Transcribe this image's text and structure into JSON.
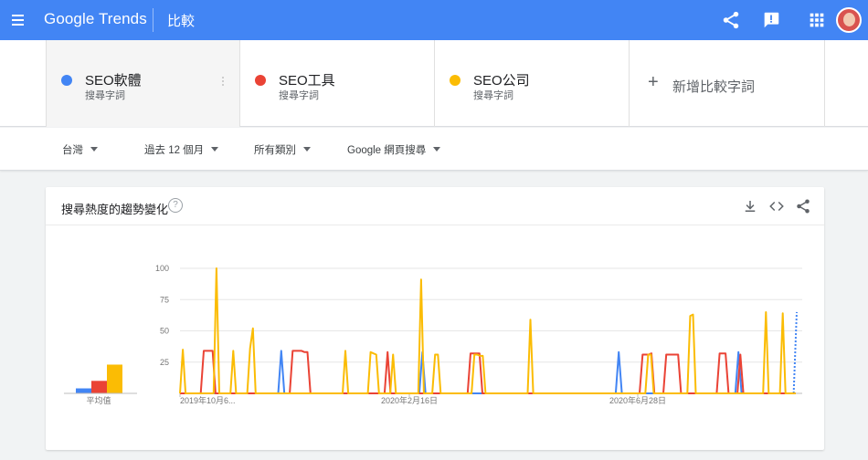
{
  "app": {
    "brand_google": "Google",
    "brand_trends": "Trends",
    "page_title": "比較"
  },
  "header_icons": [
    "menu-icon",
    "share-icon",
    "feedback-icon",
    "apps-icon",
    "avatar"
  ],
  "terms": [
    {
      "name": "SEO軟體",
      "type": "搜尋字詞",
      "color": "#4285f4"
    },
    {
      "name": "SEO工具",
      "type": "搜尋字詞",
      "color": "#ea4335"
    },
    {
      "name": "SEO公司",
      "type": "搜尋字詞",
      "color": "#fbbc04"
    }
  ],
  "add_term_label": "新增比較字詞",
  "filters": {
    "region": "台灣",
    "time_range": "過去 12 個月",
    "category": "所有類別",
    "search_type": "Google 網頁搜尋"
  },
  "card": {
    "title": "搜尋熱度的趨勢變化",
    "help": "?"
  },
  "average_label": "平均值",
  "chart_data": {
    "type": "line",
    "y_ticks": [
      "100",
      "75",
      "50",
      "25"
    ],
    "ylim": [
      0,
      100
    ],
    "x_ticks": [
      "2019年10月6...",
      "2020年2月16日",
      "2020年6月28日"
    ],
    "averages": [
      {
        "name": "SEO軟體",
        "value": 4,
        "color": "#4285f4"
      },
      {
        "name": "SEO工具",
        "value": 10,
        "color": "#ea4335"
      },
      {
        "name": "SEO公司",
        "value": 23,
        "color": "#fbbc04"
      }
    ],
    "series": [
      {
        "name": "SEO軟體",
        "color": "#4285f4",
        "values": [
          0,
          0,
          0,
          0,
          0,
          0,
          0,
          0,
          0,
          0,
          0,
          0,
          0,
          0,
          0,
          0,
          0,
          0,
          0,
          0,
          0,
          0,
          0,
          0,
          0,
          0,
          0,
          0,
          0,
          0,
          0,
          0,
          0,
          34,
          0,
          0,
          0,
          0,
          0,
          0,
          0,
          0,
          0,
          0,
          0,
          0,
          0,
          0,
          0,
          0,
          0,
          0,
          0,
          0,
          0,
          0,
          0,
          0,
          0,
          0,
          0,
          0,
          0,
          0,
          0,
          0,
          0,
          0,
          0,
          0,
          0,
          0,
          0,
          0,
          0,
          0,
          0,
          0,
          0,
          33,
          0,
          0,
          0,
          0,
          0,
          0,
          0,
          0,
          0,
          0,
          0,
          0,
          0,
          0,
          0,
          0,
          0,
          0,
          0,
          0,
          0,
          0,
          0,
          0,
          0,
          0,
          0,
          0,
          0,
          0,
          0,
          0,
          0,
          0,
          0,
          0,
          0,
          0,
          0,
          0,
          0,
          0,
          0,
          0,
          0,
          0,
          0,
          0,
          0,
          0,
          0,
          0,
          0,
          0,
          0,
          0,
          0,
          0,
          0,
          0,
          0,
          0,
          0,
          33,
          0,
          0,
          0,
          0,
          0,
          0,
          0,
          0,
          0,
          0,
          0,
          0,
          0,
          0,
          0,
          0,
          0,
          0,
          0,
          0,
          0,
          0,
          0,
          0,
          0,
          0,
          0,
          0,
          0,
          0,
          0,
          0,
          0,
          0,
          0,
          0,
          0,
          0,
          33,
          0,
          0,
          0,
          0,
          0,
          0,
          0,
          0,
          0,
          0,
          0,
          0,
          0,
          0,
          0,
          0,
          0,
          0,
          65
        ]
      },
      {
        "name": "SEO工具",
        "color": "#ea4335",
        "values": [
          0,
          0,
          0,
          0,
          0,
          0,
          0,
          0,
          34,
          34,
          34,
          34,
          0,
          0,
          0,
          0,
          0,
          0,
          0,
          0,
          0,
          0,
          0,
          0,
          0,
          0,
          0,
          0,
          0,
          0,
          0,
          0,
          0,
          0,
          0,
          0,
          0,
          0,
          34,
          34,
          34,
          34,
          33,
          33,
          0,
          0,
          0,
          0,
          0,
          0,
          0,
          0,
          0,
          0,
          0,
          0,
          0,
          0,
          0,
          0,
          0,
          0,
          0,
          0,
          0,
          0,
          0,
          0,
          0,
          0,
          33,
          0,
          0,
          0,
          0,
          0,
          0,
          0,
          0,
          0,
          0,
          0,
          0,
          0,
          0,
          0,
          0,
          0,
          0,
          0,
          0,
          0,
          0,
          0,
          0,
          0,
          0,
          0,
          32,
          32,
          32,
          32,
          0,
          0,
          0,
          0,
          0,
          0,
          0,
          0,
          0,
          0,
          0,
          0,
          0,
          0,
          0,
          0,
          0,
          0,
          0,
          0,
          0,
          0,
          0,
          0,
          0,
          0,
          0,
          0,
          0,
          0,
          0,
          0,
          0,
          0,
          0,
          0,
          0,
          0,
          0,
          0,
          0,
          0,
          0,
          0,
          0,
          0,
          0,
          0,
          0,
          0,
          0,
          0,
          0,
          0,
          31,
          31,
          31,
          32,
          0,
          0,
          0,
          0,
          31,
          31,
          31,
          31,
          31,
          0,
          0,
          0,
          0,
          0,
          0,
          0,
          0,
          0,
          0,
          0,
          0,
          0,
          32,
          32,
          32,
          0,
          0,
          0,
          0,
          31,
          0,
          0,
          0,
          0,
          0,
          0,
          0,
          0,
          0,
          0,
          0,
          0,
          0,
          0,
          0,
          0,
          0,
          0,
          0
        ]
      },
      {
        "name": "SEO公司",
        "color": "#fbbc04",
        "values": [
          0,
          35,
          0,
          0,
          0,
          0,
          0,
          0,
          0,
          0,
          0,
          0,
          0,
          100,
          0,
          0,
          0,
          0,
          0,
          34,
          0,
          0,
          0,
          0,
          0,
          36,
          52,
          0,
          0,
          0,
          0,
          0,
          0,
          0,
          0,
          0,
          0,
          0,
          0,
          0,
          0,
          0,
          0,
          0,
          0,
          0,
          0,
          0,
          0,
          0,
          0,
          0,
          0,
          0,
          0,
          0,
          0,
          0,
          0,
          34,
          0,
          0,
          0,
          0,
          0,
          0,
          0,
          0,
          33,
          32,
          31,
          0,
          0,
          0,
          0,
          0,
          31,
          0,
          0,
          0,
          0,
          0,
          0,
          0,
          0,
          0,
          91,
          0,
          0,
          0,
          0,
          31,
          31,
          0,
          0,
          0,
          0,
          0,
          0,
          0,
          0,
          0,
          0,
          0,
          0,
          31,
          31,
          30,
          30,
          0,
          0,
          0,
          0,
          0,
          0,
          0,
          0,
          0,
          0,
          0,
          0,
          0,
          0,
          0,
          0,
          59,
          0,
          0,
          0,
          0,
          0,
          0,
          0,
          0,
          0,
          0,
          0,
          0,
          0,
          0,
          0,
          0,
          0,
          0,
          0,
          0,
          0,
          0,
          0,
          0,
          0,
          0,
          0,
          0,
          0,
          0,
          0,
          0,
          0,
          0,
          0,
          0,
          0,
          0,
          0,
          0,
          0,
          31,
          31,
          0,
          0,
          0,
          0,
          0,
          0,
          0,
          0,
          0,
          0,
          0,
          0,
          0,
          62,
          63,
          0,
          0,
          0,
          0,
          0,
          0,
          0,
          0,
          0,
          0,
          0,
          0,
          0,
          0,
          0,
          0,
          0,
          0,
          0,
          0,
          0,
          0,
          0,
          0,
          0,
          65,
          0,
          0,
          0,
          0,
          0,
          64,
          0,
          0,
          0,
          0,
          0
        ]
      }
    ]
  }
}
